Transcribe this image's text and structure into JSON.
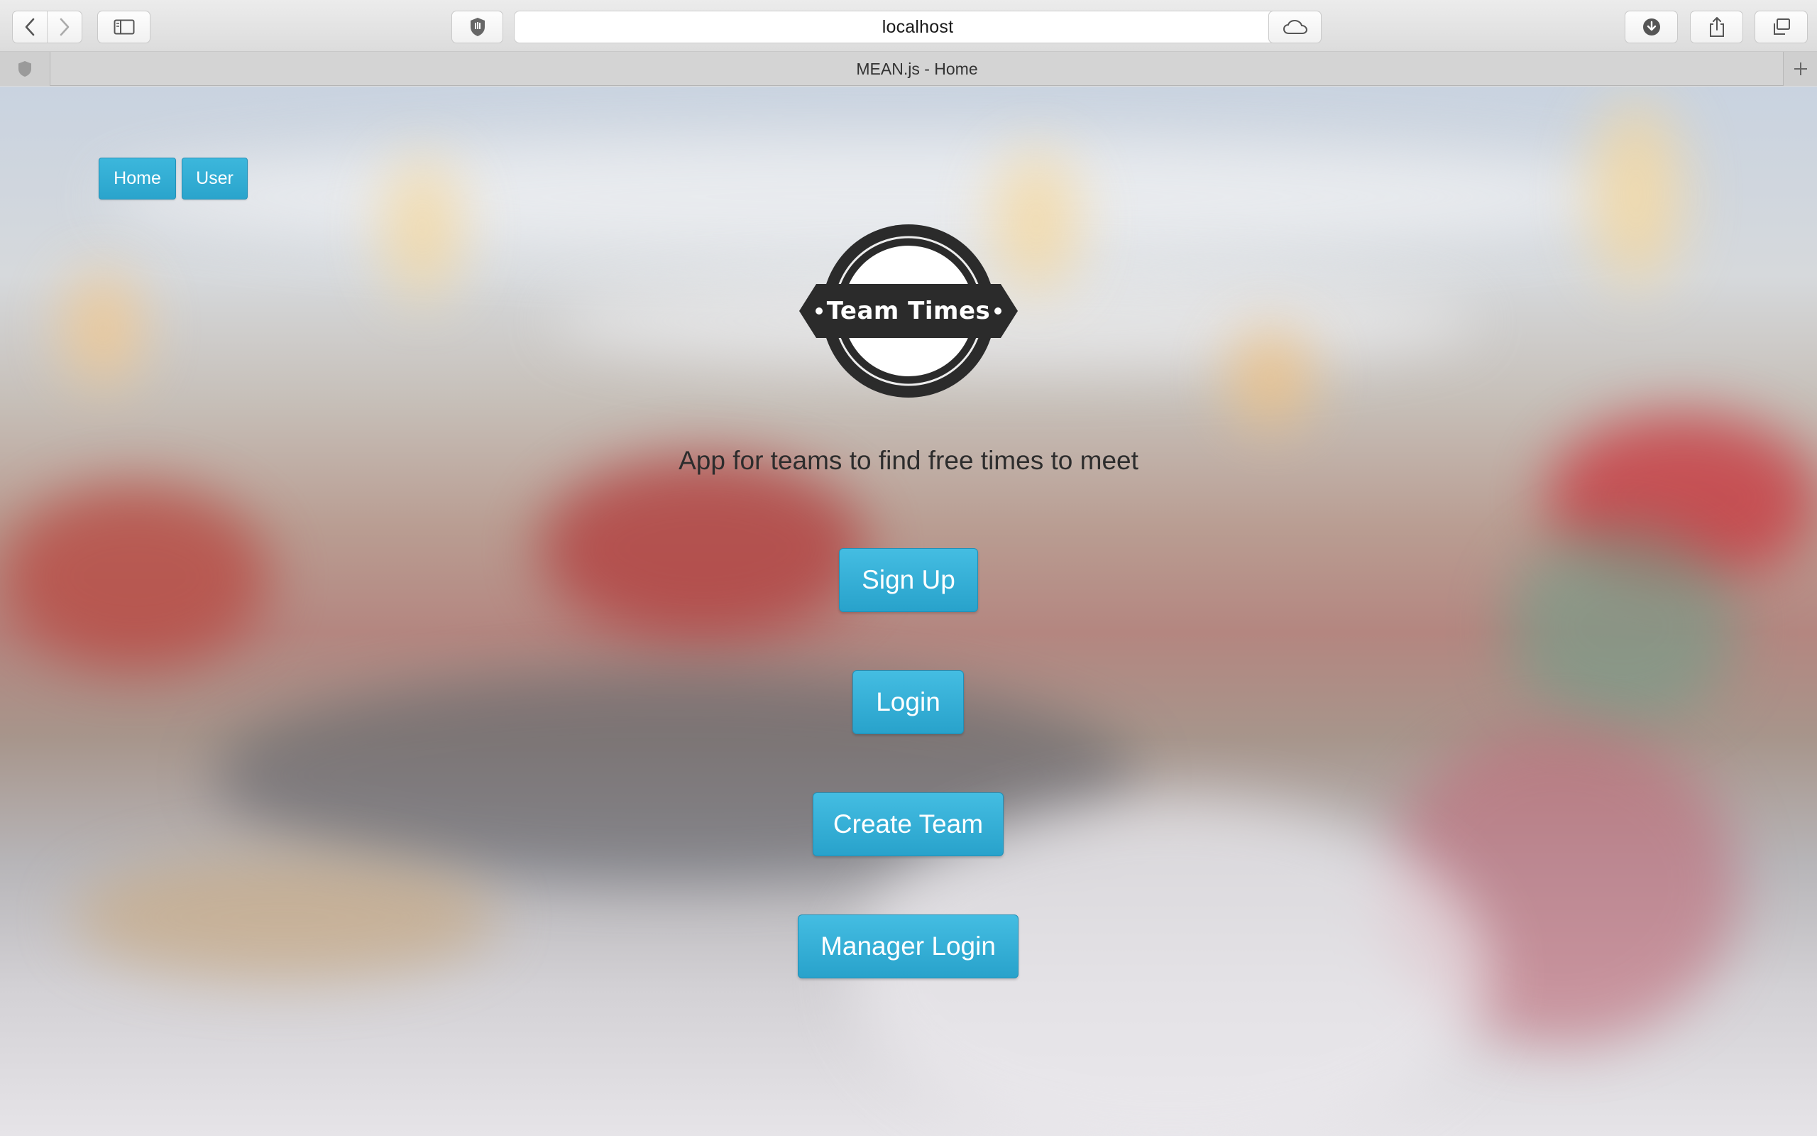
{
  "browser": {
    "url": "localhost",
    "tab_title": "MEAN.js - Home",
    "icons": [
      "back-icon",
      "forward-icon",
      "sidebar-icon",
      "privacy-shield-icon",
      "reload-icon",
      "icloud-icon",
      "downloads-icon",
      "share-icon",
      "tabs-overview-icon",
      "new-tab-icon"
    ]
  },
  "nav": {
    "home_label": "Home",
    "user_label": "User"
  },
  "logo": {
    "text": "Team Times"
  },
  "hero": {
    "tagline": "App for teams to find free times to meet"
  },
  "actions": {
    "signup_label": "Sign Up",
    "login_label": "Login",
    "create_team_label": "Create Team",
    "manager_login_label": "Manager Login"
  },
  "colors": {
    "button_primary": "#2aa4cc",
    "logo_dark": "#2b2b2b"
  }
}
